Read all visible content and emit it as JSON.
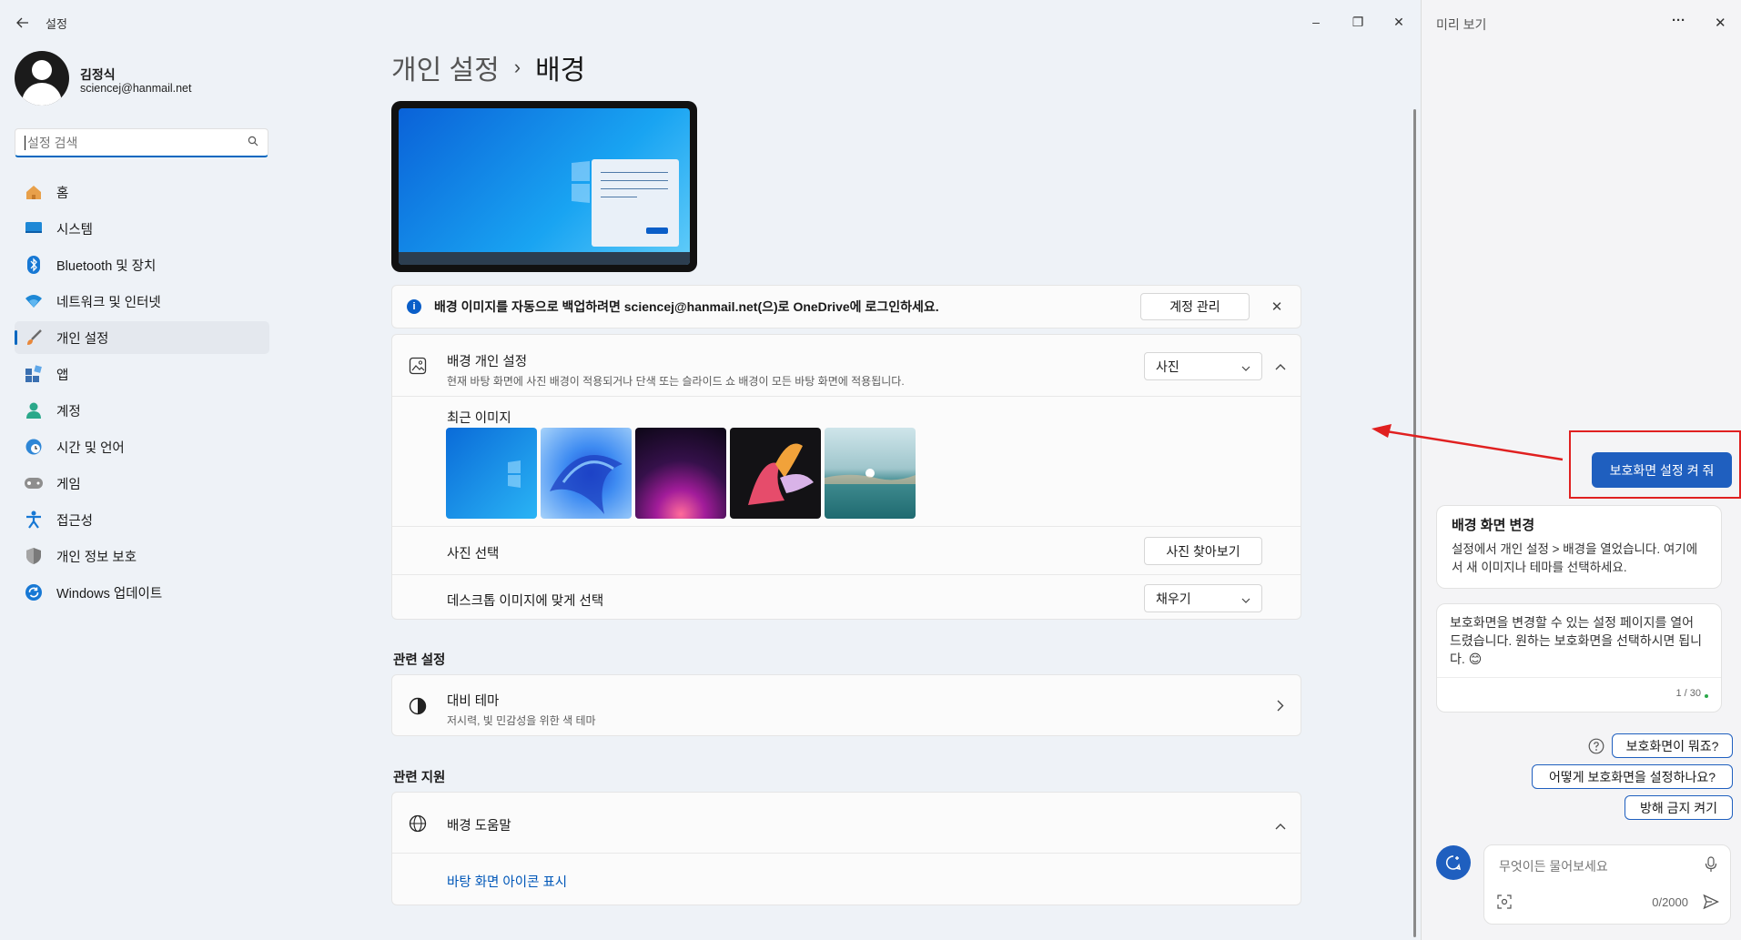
{
  "window": {
    "title": "설정",
    "controls": {
      "minimize": "–",
      "maximize": "❐",
      "close": "✕"
    }
  },
  "user": {
    "name": "김정식",
    "email": "sciencej@hanmail.net"
  },
  "search": {
    "placeholder": "설정 검색"
  },
  "sidebar": {
    "items": [
      {
        "label": "홈"
      },
      {
        "label": "시스템"
      },
      {
        "label": "Bluetooth 및 장치"
      },
      {
        "label": "네트워크 및 인터넷"
      },
      {
        "label": "개인 설정"
      },
      {
        "label": "앱"
      },
      {
        "label": "계정"
      },
      {
        "label": "시간 및 언어"
      },
      {
        "label": "게임"
      },
      {
        "label": "접근성"
      },
      {
        "label": "개인 정보 보호"
      },
      {
        "label": "Windows 업데이트"
      }
    ],
    "active_index": 4
  },
  "breadcrumb": {
    "parent": "개인 설정",
    "separator": "›",
    "current": "배경"
  },
  "info_bar": {
    "icon": "i",
    "text": "배경 이미지를 자동으로 백업하려면 sciencej@hanmail.net(으)로 OneDrive에 로그인하세요.",
    "button": "계정 관리",
    "close": "✕"
  },
  "background": {
    "title": "배경 개인 설정",
    "subtitle": "현재 바탕 화면에 사진 배경이 적용되거나 단색 또는 슬라이드 쇼 배경이 모든 바탕 화면에 적용됩니다.",
    "type_value": "사진",
    "recent_label": "최근 이미지",
    "choose_label": "사진 선택",
    "browse_button": "사진 찾아보기",
    "fit_label": "데스크톱 이미지에 맞게 선택",
    "fit_value": "채우기"
  },
  "related_settings": {
    "heading": "관련 설정",
    "contrast_title": "대비 테마",
    "contrast_sub": "저시력, 빛 민감성을 위한 색 테마"
  },
  "related_support": {
    "heading": "관련 지원",
    "help_title": "배경 도움말",
    "link": "바탕 화면 아이콘 표시"
  },
  "panel": {
    "title": "미리 보기",
    "more": "···",
    "close": "✕",
    "user_message": "보호화면 설정 켜 줘",
    "card_title": "배경 화면 변경",
    "card_body": "설정에서 개인 설정 > 배경을 열었습니다. 여기에서 새 이미지나 테마를 선택하세요.",
    "reply": "보호화면을 변경할 수 있는 설정 페이지를 열어 드렸습니다. 원하는 보호화면을 선택하시면 됩니다. 😊",
    "counter": "1 / 30",
    "suggestions": [
      "보호화면이 뭐죠?",
      "어떻게 보호화면을 설정하나요?",
      "방해 금지 켜기"
    ],
    "input_placeholder": "무엇이든 물어보세요",
    "char_count": "0/2000"
  },
  "colors": {
    "accent": "#0067c0",
    "annotation": "#e02020",
    "chat_button": "#1f5fbf"
  }
}
